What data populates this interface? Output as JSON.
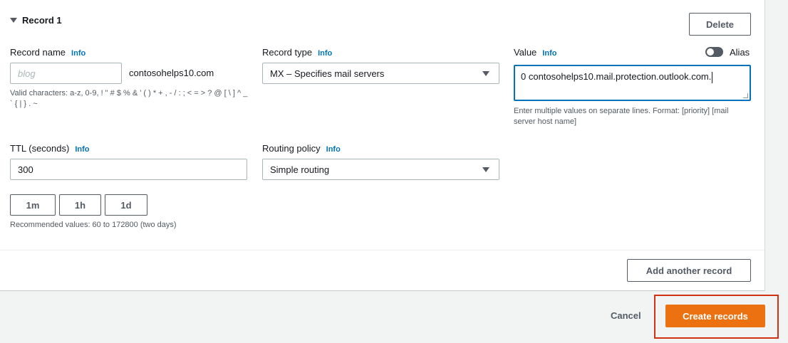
{
  "record": {
    "title": "Record 1",
    "delete_label": "Delete",
    "name": {
      "label": "Record name",
      "info": "Info",
      "placeholder": "blog",
      "suffix": "contosohelps10.com",
      "hint": "Valid characters: a-z, 0-9, ! \" # $ % & ' ( ) * + , - / : ; < = > ? @ [ \\ ] ^ _ ` { | } . ~"
    },
    "type": {
      "label": "Record type",
      "info": "Info",
      "selected": "MX – Specifies mail servers"
    },
    "value": {
      "label": "Value",
      "info": "Info",
      "alias_label": "Alias",
      "alias_enabled": false,
      "text": "0 contosohelps10.mail.protection.outlook.com.",
      "hint": "Enter multiple values on separate lines. Format: [priority] [mail server host name]"
    },
    "ttl": {
      "label": "TTL (seconds)",
      "info": "Info",
      "value": "300",
      "presets": [
        "1m",
        "1h",
        "1d"
      ],
      "hint": "Recommended values: 60 to 172800 (two days)"
    },
    "routing": {
      "label": "Routing policy",
      "info": "Info",
      "selected": "Simple routing"
    }
  },
  "add_another_label": "Add another record",
  "footer": {
    "cancel_label": "Cancel",
    "create_label": "Create records"
  },
  "colors": {
    "primary": "#ec7211",
    "link": "#0073bb",
    "highlight": "#d13212"
  }
}
